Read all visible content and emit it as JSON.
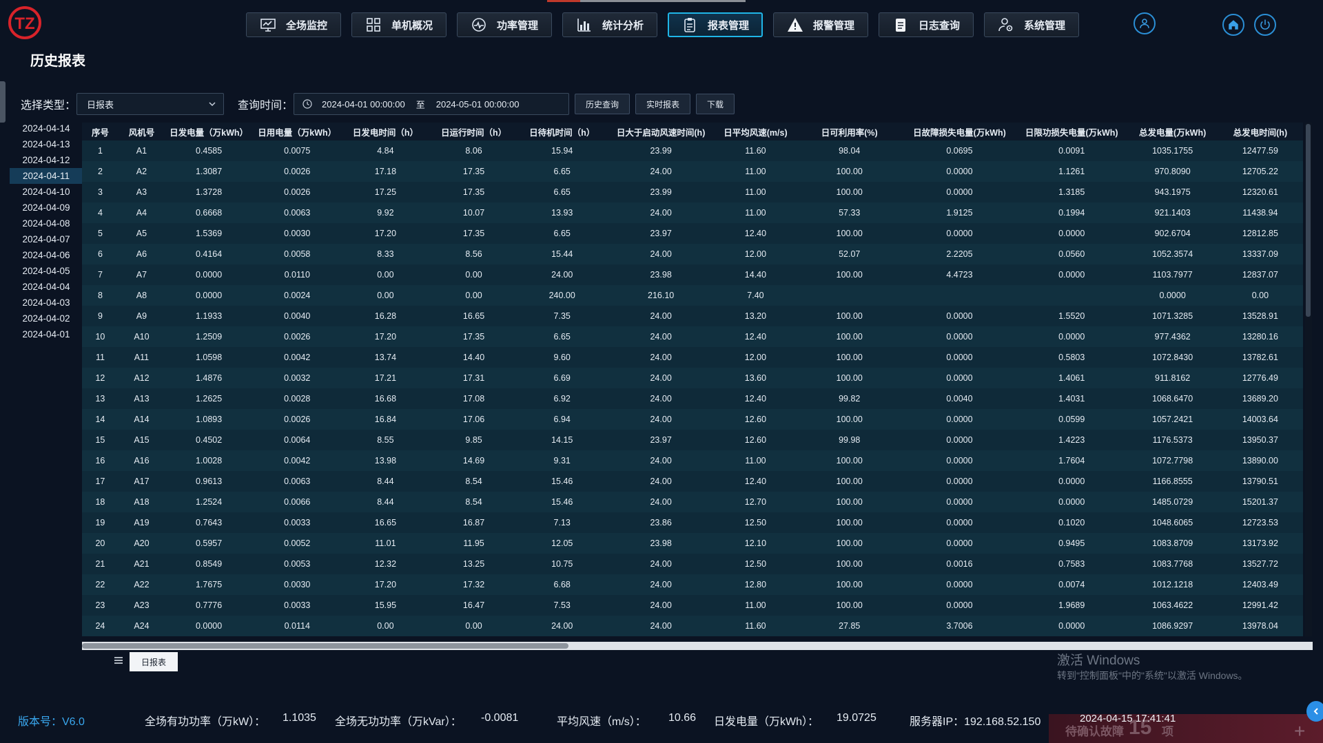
{
  "app": {
    "logo_text": "TZ"
  },
  "nav": [
    {
      "label": "全场监控",
      "icon": "monitor-icon"
    },
    {
      "label": "单机概况",
      "icon": "grid-icon"
    },
    {
      "label": "功率管理",
      "icon": "gauge-icon"
    },
    {
      "label": "统计分析",
      "icon": "bar-chart-icon"
    },
    {
      "label": "报表管理",
      "icon": "clipboard-icon",
      "active": true
    },
    {
      "label": "报警管理",
      "icon": "warning-icon"
    },
    {
      "label": "日志查询",
      "icon": "document-icon"
    },
    {
      "label": "系统管理",
      "icon": "user-gear-icon"
    }
  ],
  "page_title": "历史报表",
  "filter": {
    "type_label": "选择类型：",
    "type_value": "日报表",
    "time_label": "查询时间：",
    "start": "2024-04-01 00:00:00",
    "to": "至",
    "end": "2024-05-01 00:00:00",
    "history_btn": "历史查询",
    "realtime_btn": "实时报表",
    "download_btn": "下载"
  },
  "dates": [
    "2024-04-14",
    "2024-04-13",
    "2024-04-12",
    "2024-04-11",
    "2024-04-10",
    "2024-04-09",
    "2024-04-08",
    "2024-04-07",
    "2024-04-06",
    "2024-04-05",
    "2024-04-04",
    "2024-04-03",
    "2024-04-02",
    "2024-04-01"
  ],
  "selected_date": "2024-04-11",
  "table": {
    "columns": [
      "序号",
      "风机号",
      "日发电量（万kWh）",
      "日用电量（万kWh）",
      "日发电时间（h）",
      "日运行时间（h）",
      "日待机时间（h）",
      "日大于启动风速时间(h)",
      "日平均风速(m/s)",
      "日可利用率(%)",
      "日故障损失电量(万kWh)",
      "日限功损失电量(万kWh)",
      "总发电量(万kWh)",
      "总发电时间(h)"
    ],
    "rows": [
      [
        "1",
        "A1",
        "0.4585",
        "0.0075",
        "4.84",
        "8.06",
        "15.94",
        "23.99",
        "11.60",
        "98.04",
        "0.0695",
        "0.0091",
        "1035.1755",
        "12477.59"
      ],
      [
        "2",
        "A2",
        "1.3087",
        "0.0026",
        "17.18",
        "17.35",
        "6.65",
        "24.00",
        "11.00",
        "100.00",
        "0.0000",
        "1.1261",
        "970.8090",
        "12705.22"
      ],
      [
        "3",
        "A3",
        "1.3728",
        "0.0026",
        "17.25",
        "17.35",
        "6.65",
        "23.99",
        "11.00",
        "100.00",
        "0.0000",
        "1.3185",
        "943.1975",
        "12320.61"
      ],
      [
        "4",
        "A4",
        "0.6668",
        "0.0063",
        "9.92",
        "10.07",
        "13.93",
        "24.00",
        "11.00",
        "57.33",
        "1.9125",
        "0.1994",
        "921.1403",
        "11438.94"
      ],
      [
        "5",
        "A5",
        "1.5369",
        "0.0030",
        "17.20",
        "17.35",
        "6.65",
        "23.97",
        "12.40",
        "100.00",
        "0.0000",
        "0.0000",
        "902.6704",
        "12812.85"
      ],
      [
        "6",
        "A6",
        "0.4164",
        "0.0058",
        "8.33",
        "8.56",
        "15.44",
        "24.00",
        "12.00",
        "52.07",
        "2.2205",
        "0.0560",
        "1052.3574",
        "13337.09"
      ],
      [
        "7",
        "A7",
        "0.0000",
        "0.0110",
        "0.00",
        "0.00",
        "24.00",
        "23.98",
        "14.40",
        "100.00",
        "4.4723",
        "0.0000",
        "1103.7977",
        "12837.07"
      ],
      [
        "8",
        "A8",
        "0.0000",
        "0.0024",
        "0.00",
        "0.00",
        "240.00",
        "216.10",
        "7.40",
        "",
        "",
        "",
        "0.0000",
        "0.00"
      ],
      [
        "9",
        "A9",
        "1.1933",
        "0.0040",
        "16.28",
        "16.65",
        "7.35",
        "24.00",
        "13.20",
        "100.00",
        "0.0000",
        "1.5520",
        "1071.3285",
        "13528.91"
      ],
      [
        "10",
        "A10",
        "1.2509",
        "0.0026",
        "17.20",
        "17.35",
        "6.65",
        "24.00",
        "12.40",
        "100.00",
        "0.0000",
        "0.0000",
        "977.4362",
        "13280.16"
      ],
      [
        "11",
        "A11",
        "1.0598",
        "0.0042",
        "13.74",
        "14.40",
        "9.60",
        "24.00",
        "12.00",
        "100.00",
        "0.0000",
        "0.5803",
        "1072.8430",
        "13782.61"
      ],
      [
        "12",
        "A12",
        "1.4876",
        "0.0032",
        "17.21",
        "17.31",
        "6.69",
        "24.00",
        "13.60",
        "100.00",
        "0.0000",
        "1.4061",
        "911.8162",
        "12776.49"
      ],
      [
        "13",
        "A13",
        "1.2625",
        "0.0028",
        "16.68",
        "17.08",
        "6.92",
        "24.00",
        "12.40",
        "99.82",
        "0.0040",
        "1.4031",
        "1068.6470",
        "13689.20"
      ],
      [
        "14",
        "A14",
        "1.0893",
        "0.0026",
        "16.84",
        "17.06",
        "6.94",
        "24.00",
        "12.60",
        "100.00",
        "0.0000",
        "0.0599",
        "1057.2421",
        "14003.64"
      ],
      [
        "15",
        "A15",
        "0.4502",
        "0.0064",
        "8.55",
        "9.85",
        "14.15",
        "23.97",
        "12.60",
        "99.98",
        "0.0000",
        "1.4223",
        "1176.5373",
        "13950.37"
      ],
      [
        "16",
        "A16",
        "1.0028",
        "0.0042",
        "13.98",
        "14.69",
        "9.31",
        "24.00",
        "11.00",
        "100.00",
        "0.0000",
        "1.7604",
        "1072.7798",
        "13890.00"
      ],
      [
        "17",
        "A17",
        "0.9613",
        "0.0063",
        "8.44",
        "8.54",
        "15.46",
        "24.00",
        "12.40",
        "100.00",
        "0.0000",
        "0.0000",
        "1166.8555",
        "13790.51"
      ],
      [
        "18",
        "A18",
        "1.2524",
        "0.0066",
        "8.44",
        "8.54",
        "15.46",
        "24.00",
        "12.70",
        "100.00",
        "0.0000",
        "0.0000",
        "1485.0729",
        "15201.37"
      ],
      [
        "19",
        "A19",
        "0.7643",
        "0.0033",
        "16.65",
        "16.87",
        "7.13",
        "23.86",
        "12.50",
        "100.00",
        "0.0000",
        "0.1020",
        "1048.6065",
        "12723.53"
      ],
      [
        "20",
        "A20",
        "0.5957",
        "0.0052",
        "11.01",
        "11.95",
        "12.05",
        "23.98",
        "12.10",
        "100.00",
        "0.0000",
        "0.9495",
        "1083.8709",
        "13173.92"
      ],
      [
        "21",
        "A21",
        "0.8549",
        "0.0053",
        "12.32",
        "13.25",
        "10.75",
        "24.00",
        "12.50",
        "100.00",
        "0.0016",
        "0.7583",
        "1083.7768",
        "13527.72"
      ],
      [
        "22",
        "A22",
        "1.7675",
        "0.0030",
        "17.20",
        "17.32",
        "6.68",
        "24.00",
        "12.80",
        "100.00",
        "0.0000",
        "0.0074",
        "1012.1218",
        "12403.49"
      ],
      [
        "23",
        "A23",
        "0.7776",
        "0.0033",
        "15.95",
        "16.47",
        "7.53",
        "24.00",
        "11.00",
        "100.00",
        "0.0000",
        "1.9689",
        "1063.4622",
        "12991.42"
      ],
      [
        "24",
        "A24",
        "0.0000",
        "0.0114",
        "0.00",
        "0.00",
        "24.00",
        "24.00",
        "11.60",
        "27.85",
        "3.7006",
        "0.0000",
        "1086.9297",
        "13978.04"
      ]
    ]
  },
  "sheet_tab": "日报表",
  "watermark": {
    "line1": "激活 Windows",
    "line2": "转到\"控制面板\"中的\"系统\"以激活 Windows。"
  },
  "status": {
    "version": "版本号：V6.0",
    "active_power_label": "全场有功功率（万kW）：",
    "active_power": "1.1035",
    "reactive_power_label": "全场无功功率（万kVar）：",
    "reactive_power": "-0.0081",
    "avg_wind_label": "平均风速（m/s）：",
    "avg_wind": "10.66",
    "daily_gen_label": "日发电量（万kWh）：",
    "daily_gen": "19.0725",
    "server_ip": "服务器IP：192.168.52.150",
    "datetime": "2024-04-15 17:41:41",
    "alarm_text": "待确认故障",
    "alarm_count": "15",
    "alarm_unit": "项"
  },
  "colors": {
    "accent": "#1fb6e8",
    "brand": "#c0392b",
    "background": "#0b1322"
  }
}
